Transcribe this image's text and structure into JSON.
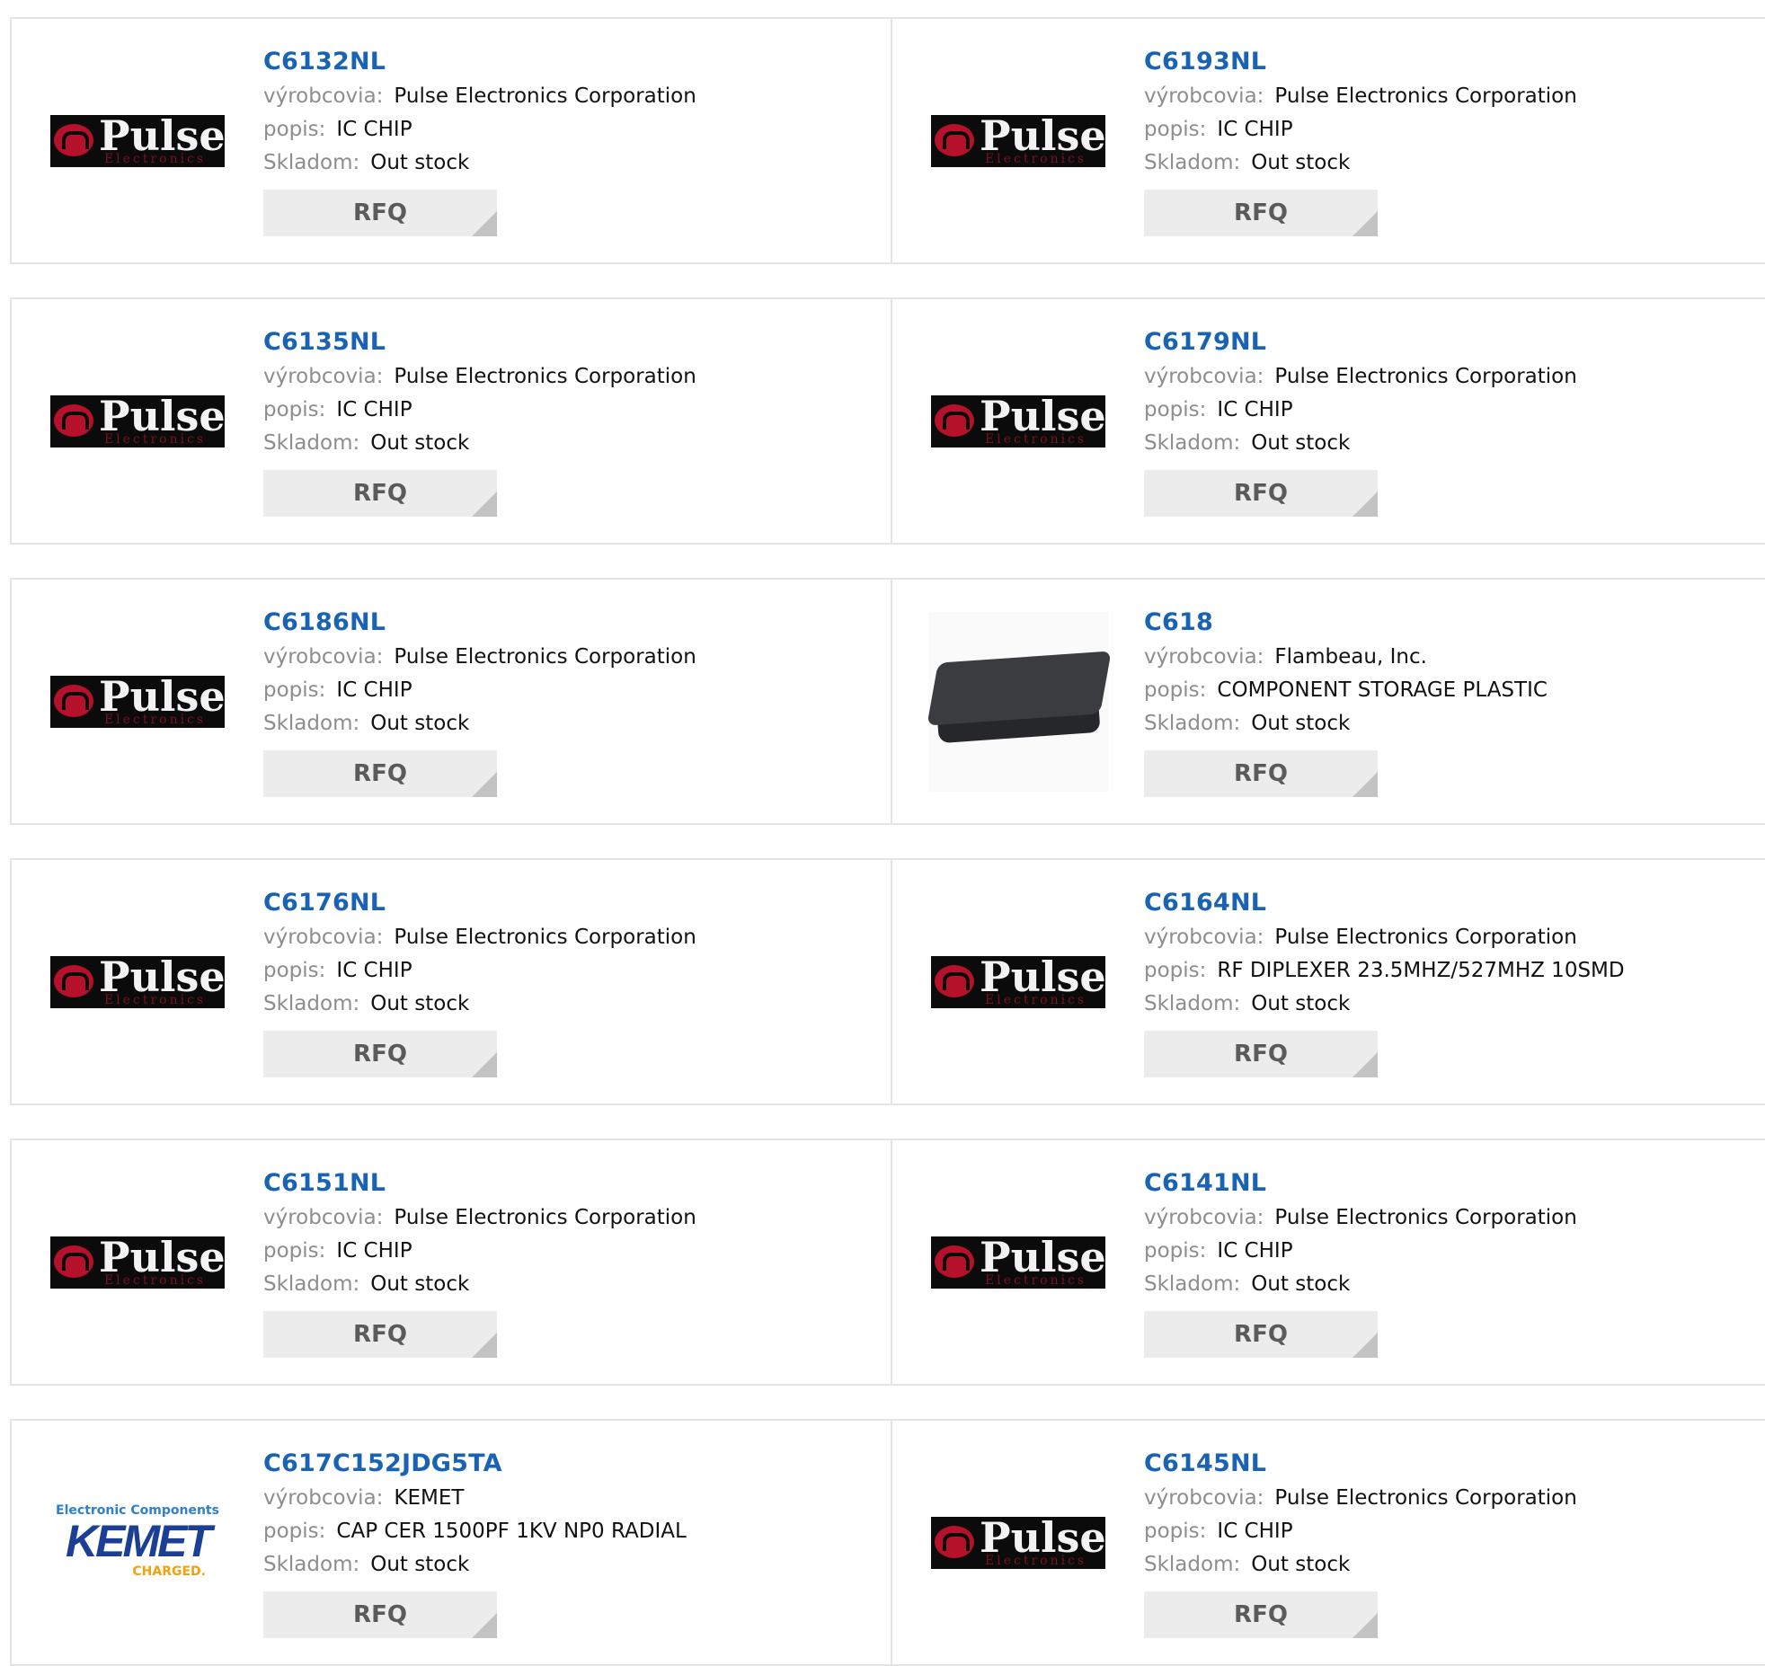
{
  "labels": {
    "manufacturer": "výrobcovia:",
    "description": "popis:",
    "stock": "Skladom:",
    "rfq": "RFQ"
  },
  "logos": {
    "pulse_name": "Pulse",
    "pulse_sub": "Electronics",
    "kemet_top": "Electronic Components",
    "kemet_main": "KEMET",
    "kemet_sub": "CHARGED."
  },
  "colors": {
    "part_link": "#1a63b4",
    "label_gray": "#8d8d8d",
    "rfq_bg": "#ececec",
    "border": "#e4e4e4"
  },
  "products": [
    {
      "part": "C6132NL",
      "manufacturer": "Pulse Electronics Corporation",
      "description": "IC CHIP",
      "stock": "Out stock",
      "logo": "pulse"
    },
    {
      "part": "C6193NL",
      "manufacturer": "Pulse Electronics Corporation",
      "description": "IC CHIP",
      "stock": "Out stock",
      "logo": "pulse"
    },
    {
      "part": "C6135NL",
      "manufacturer": "Pulse Electronics Corporation",
      "description": "IC CHIP",
      "stock": "Out stock",
      "logo": "pulse"
    },
    {
      "part": "C6179NL",
      "manufacturer": "Pulse Electronics Corporation",
      "description": "IC CHIP",
      "stock": "Out stock",
      "logo": "pulse"
    },
    {
      "part": "C6186NL",
      "manufacturer": "Pulse Electronics Corporation",
      "description": "IC CHIP",
      "stock": "Out stock",
      "logo": "pulse"
    },
    {
      "part": "C618",
      "manufacturer": "Flambeau, Inc.",
      "description": "COMPONENT STORAGE PLASTIC",
      "stock": "Out stock",
      "logo": "storage-box"
    },
    {
      "part": "C6176NL",
      "manufacturer": "Pulse Electronics Corporation",
      "description": "IC CHIP",
      "stock": "Out stock",
      "logo": "pulse"
    },
    {
      "part": "C6164NL",
      "manufacturer": "Pulse Electronics Corporation",
      "description": "RF DIPLEXER 23.5MHZ/527MHZ 10SMD",
      "stock": "Out stock",
      "logo": "pulse"
    },
    {
      "part": "C6151NL",
      "manufacturer": "Pulse Electronics Corporation",
      "description": "IC CHIP",
      "stock": "Out stock",
      "logo": "pulse"
    },
    {
      "part": "C6141NL",
      "manufacturer": "Pulse Electronics Corporation",
      "description": "IC CHIP",
      "stock": "Out stock",
      "logo": "pulse"
    },
    {
      "part": "C617C152JDG5TA",
      "manufacturer": "KEMET",
      "description": "CAP CER 1500PF 1KV NP0 RADIAL",
      "stock": "Out stock",
      "logo": "kemet"
    },
    {
      "part": "C6145NL",
      "manufacturer": "Pulse Electronics Corporation",
      "description": "IC CHIP",
      "stock": "Out stock",
      "logo": "pulse"
    }
  ]
}
